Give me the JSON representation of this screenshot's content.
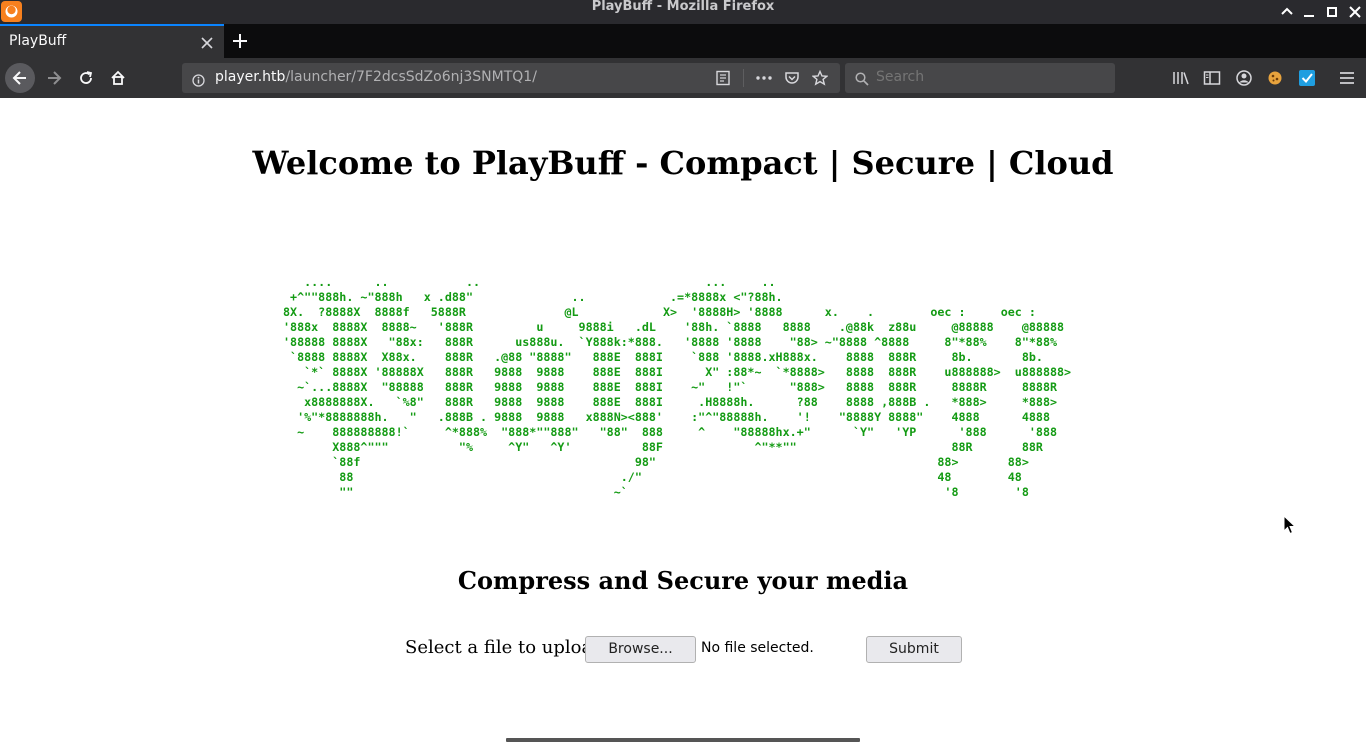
{
  "window": {
    "title": "PlayBuff - Mozilla Firefox"
  },
  "tabs": [
    {
      "label": "PlayBuff",
      "active": true
    }
  ],
  "address_bar": {
    "host": "player.htb",
    "path": "/launcher/7F2dcsSdZo6nj3SNMTQ1/"
  },
  "search_bar": {
    "placeholder": "Search"
  },
  "page": {
    "title": "Welcome to PlayBuff - Compact | Secure | Cloud",
    "ascii_art": "   ....      ..           ..                                ...     ..\n +^\"\"888h. ~\"888h   x .d88\"              ..            .=*8888x <\"?88h.\n8X.  ?8888X  8888f   5888R              @L            X>  '8888H> '8888      x.    .        oec :     oec :\n'888x  8888X  8888~   '888R         u     9888i   .dL    '88h. `8888   8888    .@88k  z88u     @88888    @88888\n'88888 8888X   \"88x:   888R      us888u.  `Y888k:*888.   '8888 '8888    \"88> ~\"8888 ^8888     8\"*88%    8\"*88%\n `8888 8888X  X88x.    888R   .@88 \"8888\"   888E  888I    `888 '8888.xH888x.    8888  888R     8b.       8b.\n   `*` 8888X '88888X   888R   9888  9888    888E  888I      X\" :88*~  `*8888>   8888  888R    u888888>  u888888>\n  ~`...8888X  \"88888   888R   9888  9888    888E  888I    ~\"   !\"`      \"888>   8888  888R     8888R     8888R\n   x8888888X.   `%8\"   888R   9888  9888    888E  888I     .H8888h.      ?88    8888 ,888B .   *888>     *888>\n  '%\"*8888888h.   \"   .888B . 9888  9888   x888N><888'    :\"^\"88888h.    '!    \"8888Y 8888\"    4888      4888\n  ~    888888888!`     ^*888%  \"888*\"\"888\"   \"88\"  888     ^    \"88888hx.+\"      `Y\"   'YP      '888      '888\n       X888^\"\"\"          \"%     ^Y\"   ^Y'          88F             ^\"**\"\"                      88R       88R\n       `88f                                       98\"                                        88>       88>\n        88                                      ./\"                                          48        48\n        \"\"                                     ~`                                             '8        '8",
    "subtitle": "Compress and Secure your media",
    "upload_label": "Select a file to upload",
    "browse_label": "Browse...",
    "file_status": "No file selected.",
    "submit_label": "Submit"
  },
  "colors": {
    "ascii_green": "#149b14",
    "accent": "#0a84ff",
    "chrome_dark": "#2a2a2e",
    "toolbar": "#323234"
  },
  "icons": [
    "firefox-icon",
    "minimize-icon",
    "maximize-icon",
    "close-icon",
    "tab-close-icon",
    "new-tab-icon",
    "back-icon",
    "forward-icon",
    "reload-icon",
    "home-icon",
    "info-icon",
    "reader-view-icon",
    "page-actions-icon",
    "pocket-icon",
    "bookmark-star-icon",
    "search-icon",
    "library-icon",
    "sidebar-icon",
    "account-icon",
    "extension-icon",
    "extension-check-icon",
    "menu-icon",
    "mouse-cursor-icon"
  ]
}
